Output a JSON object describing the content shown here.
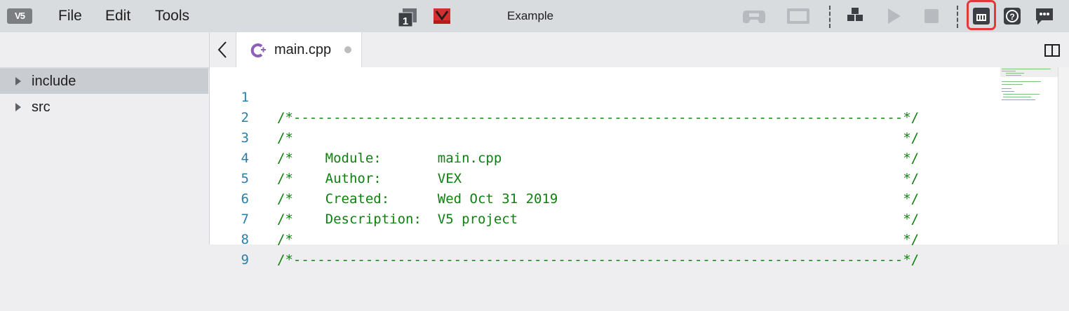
{
  "app": {
    "logo_text": "V5",
    "title": "Example",
    "menu": [
      "File",
      "Edit",
      "Tools"
    ],
    "slot_number": "1",
    "toolbar_icons": [
      "controller-icon",
      "brain-screen-icon",
      "blocks-icon",
      "play-icon",
      "stop-icon",
      "device-info-icon",
      "help-icon",
      "feedback-icon"
    ]
  },
  "sidebar": {
    "items": [
      {
        "label": "include",
        "selected": true
      },
      {
        "label": "src",
        "selected": false
      }
    ]
  },
  "tabs": [
    {
      "label": "main.cpp",
      "modified": true
    }
  ],
  "editor": {
    "lines": [
      {
        "num": "1",
        "text": "/*----------------------------------------------------------------------------*/"
      },
      {
        "num": "2",
        "text": "/*                                                                            */"
      },
      {
        "num": "3",
        "text": "/*    Module:       main.cpp                                                  */"
      },
      {
        "num": "4",
        "text": "/*    Author:       VEX                                                       */"
      },
      {
        "num": "5",
        "text": "/*    Created:      Wed Oct 31 2019                                           */"
      },
      {
        "num": "6",
        "text": "/*    Description:  V5 project                                                */"
      },
      {
        "num": "7",
        "text": "/*                                                                            */"
      },
      {
        "num": "8",
        "text": "/*----------------------------------------------------------------------------*/"
      },
      {
        "num": "9",
        "text": ""
      }
    ]
  },
  "colors": {
    "comment": "#108010",
    "line_number": "#2b7fa8",
    "highlight": "#e53935",
    "vex_red": "#d32f2f"
  }
}
